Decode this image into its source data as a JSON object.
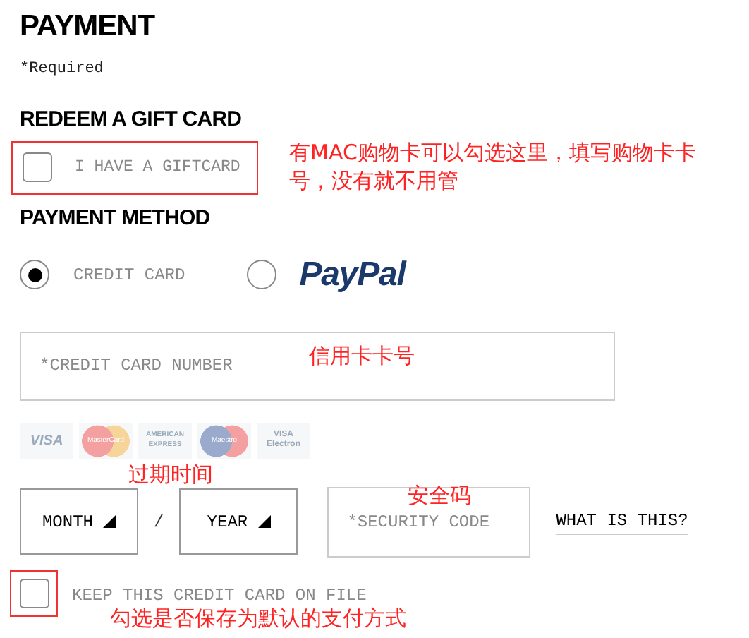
{
  "title": "PAYMENT",
  "required_note": "*Required",
  "gift_card": {
    "heading": "REDEEM A GIFT CARD",
    "label": "I HAVE A GIFTCARD",
    "checked": false
  },
  "payment_method": {
    "heading": "PAYMENT METHOD",
    "options": [
      {
        "kind": "text",
        "label": "CREDIT CARD",
        "selected": true
      },
      {
        "kind": "logo",
        "label": "PayPal",
        "selected": false
      }
    ]
  },
  "card_number": {
    "placeholder": "*CREDIT CARD NUMBER"
  },
  "card_logos": [
    {
      "lines": [
        "VISA"
      ]
    },
    {
      "lines": [
        "MasterCard"
      ]
    },
    {
      "lines": [
        "AMERICAN",
        "EXPRESS"
      ]
    },
    {
      "lines": [
        "Maestro"
      ]
    },
    {
      "lines": [
        "VISA",
        "Electron"
      ]
    }
  ],
  "expiry": {
    "month": "MONTH",
    "separator": "/",
    "year": "YEAR"
  },
  "security_code": {
    "placeholder": "*SECURITY CODE"
  },
  "what_is_this": "WHAT IS THIS?",
  "keep_card": {
    "label": "KEEP THIS CREDIT CARD ON FILE",
    "checked": false
  },
  "annotations": [
    {
      "text": "有MAC购物卡可以勾选这里，填写购物卡卡号，没有就不用管"
    },
    {
      "text": "信用卡卡号"
    },
    {
      "text": "过期时间"
    },
    {
      "text": "安全码"
    },
    {
      "text": "勾选是否保存为默认的支付方式"
    }
  ]
}
